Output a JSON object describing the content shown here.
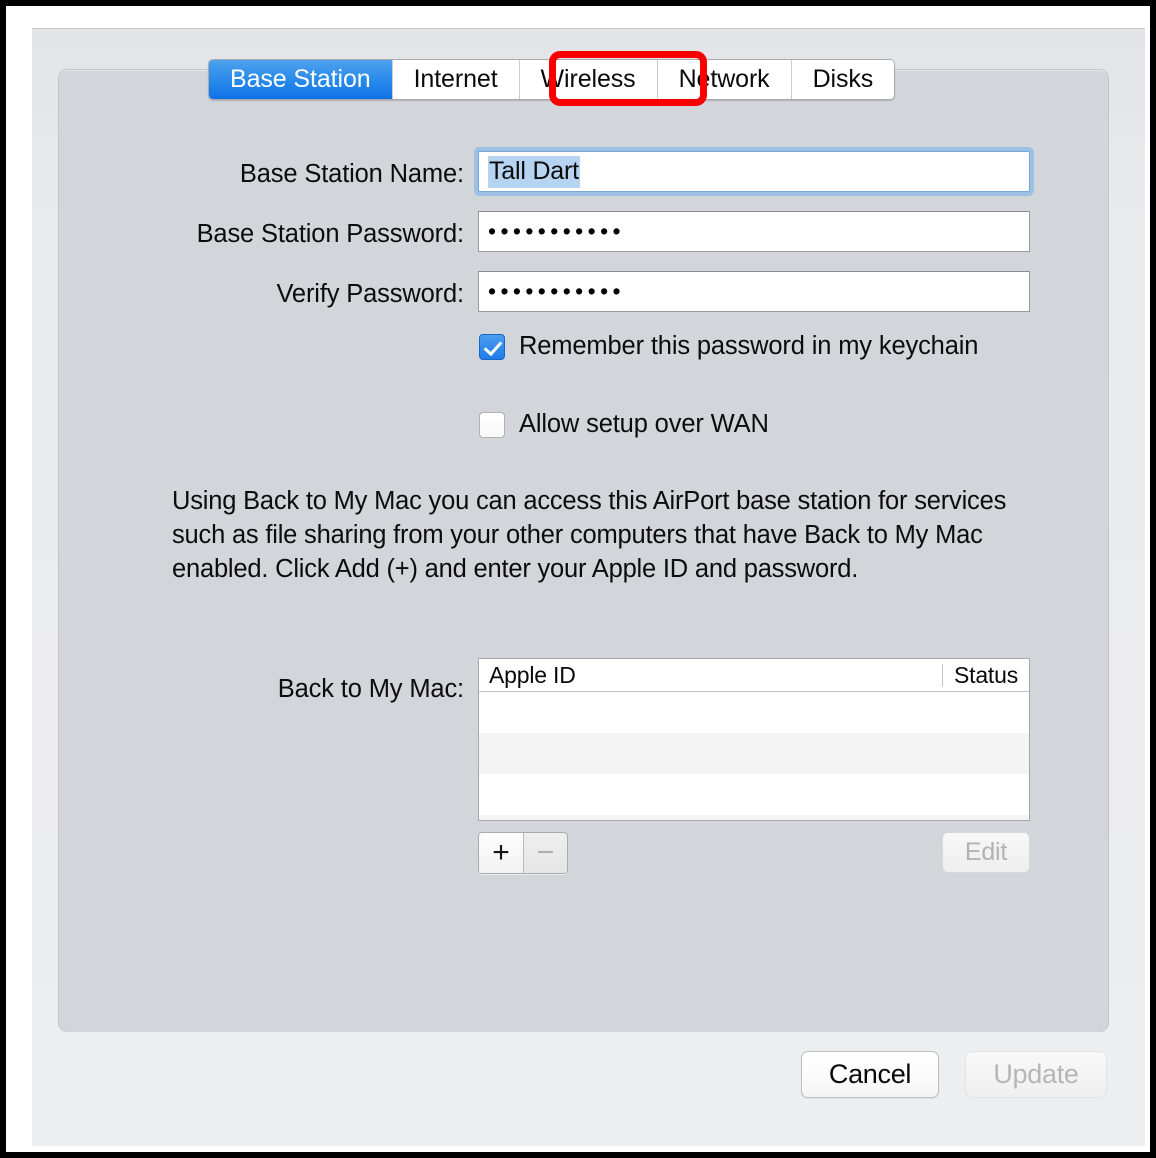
{
  "window": {
    "tabs": [
      {
        "label": "Base Station",
        "selected": true
      },
      {
        "label": "Internet",
        "selected": false
      },
      {
        "label": "Wireless",
        "selected": false,
        "annotated": true
      },
      {
        "label": "Network",
        "selected": false
      },
      {
        "label": "Disks",
        "selected": false
      }
    ],
    "annotation_color": "#f90000"
  },
  "form": {
    "base_station_name": {
      "label": "Base Station Name:",
      "value": "Tall Dart",
      "focused": true,
      "selected": true
    },
    "base_station_password": {
      "label": "Base Station Password:",
      "value": "•••••••••••",
      "dot_count": 11
    },
    "verify_password": {
      "label": "Verify Password:",
      "value": "•••••••••••",
      "dot_count": 11
    },
    "remember_password": {
      "label": "Remember this password in my keychain",
      "checked": true
    },
    "allow_wan": {
      "label": "Allow setup over WAN",
      "checked": false
    }
  },
  "description": "Using Back to My Mac you can access this AirPort base station for services such as file sharing from your other computers that have Back to My Mac enabled. Click Add (+) and enter your Apple ID and password.",
  "back_to_my_mac": {
    "label": "Back to My Mac:",
    "columns": [
      "Apple ID",
      "Status"
    ],
    "rows": [],
    "add_button": "+",
    "remove_button": "−",
    "edit_button": "Edit",
    "edit_enabled": false,
    "remove_enabled": false
  },
  "footer": {
    "cancel": "Cancel",
    "update": "Update",
    "update_enabled": false
  },
  "accent_colors": {
    "tab_selected": "#2b8ceb",
    "checkbox_on": "#1f7de8",
    "focus_ring": "#9dc1e4",
    "text_selection": "#b6d3f2",
    "annotation": "#f90000"
  }
}
